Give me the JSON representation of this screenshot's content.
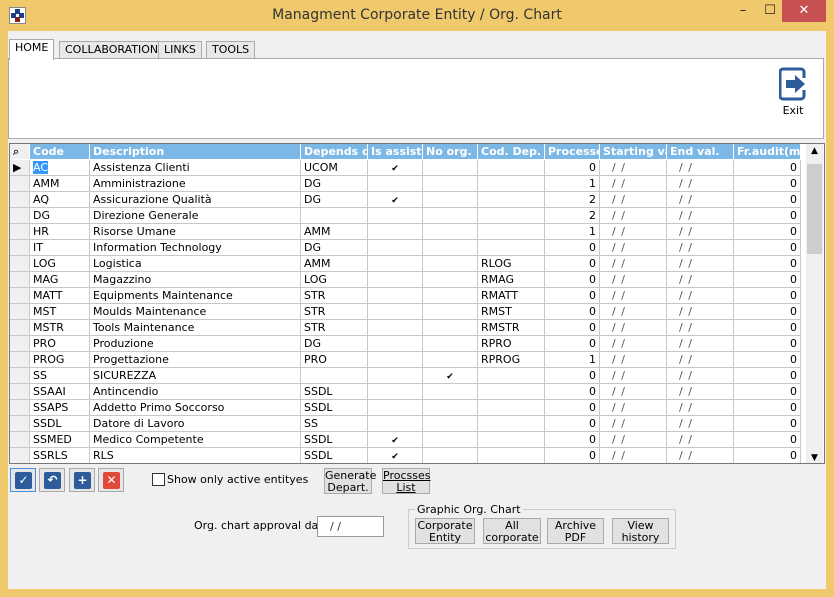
{
  "window": {
    "title": "Managment Corporate Entity / Org. Chart",
    "minimize": "–",
    "maximize": "☐",
    "close": "✕",
    "brand_color": "#f0c96c"
  },
  "tabs": [
    {
      "label": "HOME",
      "active": true
    },
    {
      "label": "COLLABORATION"
    },
    {
      "label": "LINKS"
    },
    {
      "label": "TOOLS"
    }
  ],
  "ribbon": {
    "exit_label": "Exit",
    "exit_icon": "exit-door-arrow-icon"
  },
  "grid": {
    "columns": [
      "Code",
      "Description",
      "Depends on",
      "Is assist.",
      "No org.",
      "Cod. Dep.",
      "Processes",
      "Starting vali",
      "End val.",
      "Fr.audit(mo"
    ],
    "rows": [
      {
        "code": "AC",
        "desc": "Assistenza Clienti",
        "dep": "UCOM",
        "assist": true,
        "noorg": false,
        "coddep": "",
        "proc": "0",
        "start": "/ /",
        "end": "/ /",
        "audit": "0",
        "current": true
      },
      {
        "code": "AMM",
        "desc": "Amministrazione",
        "dep": "DG",
        "assist": false,
        "noorg": false,
        "coddep": "",
        "proc": "1",
        "start": "/ /",
        "end": "/ /",
        "audit": "0"
      },
      {
        "code": "AQ",
        "desc": "Assicurazione Qualità",
        "dep": "DG",
        "assist": true,
        "noorg": false,
        "coddep": "",
        "proc": "2",
        "start": "/ /",
        "end": "/ /",
        "audit": "0"
      },
      {
        "code": "DG",
        "desc": "Direzione Generale",
        "dep": "",
        "assist": false,
        "noorg": false,
        "coddep": "",
        "proc": "2",
        "start": "/ /",
        "end": "/ /",
        "audit": "0"
      },
      {
        "code": "HR",
        "desc": "Risorse Umane",
        "dep": "AMM",
        "assist": false,
        "noorg": false,
        "coddep": "",
        "proc": "1",
        "start": "/ /",
        "end": "/ /",
        "audit": "0"
      },
      {
        "code": "IT",
        "desc": "Information Technology",
        "dep": "DG",
        "assist": false,
        "noorg": false,
        "coddep": "",
        "proc": "0",
        "start": "/ /",
        "end": "/ /",
        "audit": "0"
      },
      {
        "code": "LOG",
        "desc": "Logistica",
        "dep": "AMM",
        "assist": false,
        "noorg": false,
        "coddep": "RLOG",
        "proc": "0",
        "start": "/ /",
        "end": "/ /",
        "audit": "0"
      },
      {
        "code": "MAG",
        "desc": "Magazzino",
        "dep": "LOG",
        "assist": false,
        "noorg": false,
        "coddep": "RMAG",
        "proc": "0",
        "start": "/ /",
        "end": "/ /",
        "audit": "0"
      },
      {
        "code": "MATT",
        "desc": "Equipments Maintenance",
        "dep": "STR",
        "assist": false,
        "noorg": false,
        "coddep": "RMATT",
        "proc": "0",
        "start": "/ /",
        "end": "/ /",
        "audit": "0"
      },
      {
        "code": "MST",
        "desc": "Moulds Maintenance",
        "dep": "STR",
        "assist": false,
        "noorg": false,
        "coddep": "RMST",
        "proc": "0",
        "start": "/ /",
        "end": "/ /",
        "audit": "0"
      },
      {
        "code": "MSTR",
        "desc": "Tools Maintenance",
        "dep": "STR",
        "assist": false,
        "noorg": false,
        "coddep": "RMSTR",
        "proc": "0",
        "start": "/ /",
        "end": "/ /",
        "audit": "0"
      },
      {
        "code": "PRO",
        "desc": "Produzione",
        "dep": "DG",
        "assist": false,
        "noorg": false,
        "coddep": "RPRO",
        "proc": "0",
        "start": "/ /",
        "end": "/ /",
        "audit": "0"
      },
      {
        "code": "PROG",
        "desc": "Progettazione",
        "dep": "PRO",
        "assist": false,
        "noorg": false,
        "coddep": "RPROG",
        "proc": "1",
        "start": "/ /",
        "end": "/ /",
        "audit": "0"
      },
      {
        "code": "SS",
        "desc": "SICUREZZA",
        "dep": "",
        "assist": false,
        "noorg": true,
        "coddep": "",
        "proc": "0",
        "start": "/ /",
        "end": "/ /",
        "audit": "0"
      },
      {
        "code": "SSAAI",
        "desc": "Antincendio",
        "dep": "SSDL",
        "assist": false,
        "noorg": false,
        "coddep": "",
        "proc": "0",
        "start": "/ /",
        "end": "/ /",
        "audit": "0"
      },
      {
        "code": "SSAPS",
        "desc": "Addetto Primo Soccorso",
        "dep": "SSDL",
        "assist": false,
        "noorg": false,
        "coddep": "",
        "proc": "0",
        "start": "/ /",
        "end": "/ /",
        "audit": "0"
      },
      {
        "code": "SSDL",
        "desc": "Datore di Lavoro",
        "dep": "SS",
        "assist": false,
        "noorg": false,
        "coddep": "",
        "proc": "0",
        "start": "/ /",
        "end": "/ /",
        "audit": "0"
      },
      {
        "code": "SSMED",
        "desc": "Medico Competente",
        "dep": "SSDL",
        "assist": true,
        "noorg": false,
        "coddep": "",
        "proc": "0",
        "start": "/ /",
        "end": "/ /",
        "audit": "0"
      },
      {
        "code": "SSRLS",
        "desc": "RLS",
        "dep": "SSDL",
        "assist": true,
        "noorg": false,
        "coddep": "",
        "proc": "0",
        "start": "/ /",
        "end": "/ /",
        "audit": "0"
      }
    ]
  },
  "toolbar": {
    "confirm_icon": "check-icon",
    "undo_icon": "undo-icon",
    "add_icon": "plus-icon",
    "delete_icon": "x-icon",
    "show_active_label": "Show only active entityes",
    "show_active_checked": false,
    "generate_label": "Generate Depart.",
    "processes_label": "Procsses List"
  },
  "approval": {
    "label": "Org. chart approval date",
    "value": "/ /"
  },
  "graphic": {
    "title": "Graphic Org. Chart",
    "buttons": [
      "Corporate Entity",
      "All corporate",
      "Archive PDF",
      "View history"
    ]
  }
}
